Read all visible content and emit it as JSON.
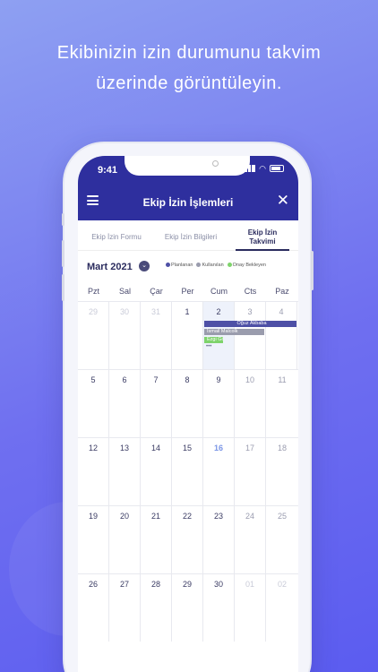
{
  "headline": {
    "line1": "Ekibinizin izin durumunu takvim",
    "line2": "üzerinde görüntüleyin."
  },
  "status": {
    "time": "9:41"
  },
  "header": {
    "title": "Ekip İzin İşlemleri"
  },
  "tabs": [
    {
      "label": "Ekip İzin Formu"
    },
    {
      "label": "Ekip İzin Bilgileri"
    },
    {
      "label_line1": "Ekip İzin",
      "label_line2": "Takvimi"
    }
  ],
  "calendar": {
    "month": "Mart 2021",
    "legend": [
      {
        "label": "Planlanan",
        "color": "#4e50a6"
      },
      {
        "label": "Kullanılan",
        "color": "#9a9cad"
      },
      {
        "label": "Onay Bekleyen",
        "color": "#7ed36b"
      }
    ],
    "weekdays": [
      "Pzt",
      "Sal",
      "Çar",
      "Per",
      "Cum",
      "Cts",
      "Paz"
    ],
    "weeks": [
      [
        "29",
        "30",
        "31",
        "1",
        "2",
        "3",
        "4"
      ],
      [
        "5",
        "6",
        "7",
        "8",
        "9",
        "10",
        "11"
      ],
      [
        "12",
        "13",
        "14",
        "15",
        "16",
        "17",
        "18"
      ],
      [
        "19",
        "20",
        "21",
        "22",
        "23",
        "24",
        "25"
      ],
      [
        "26",
        "27",
        "28",
        "29",
        "30",
        "01",
        "02"
      ]
    ],
    "events": {
      "planned": "Oğuz Akbaba",
      "used": "İsmail Malcolk",
      "pending": "Ezgi Göka",
      "more": "•••"
    }
  },
  "colors": {
    "accent": "#2e2f9e",
    "background_start": "#8ea0f2",
    "background_end": "#5b5cf0"
  }
}
